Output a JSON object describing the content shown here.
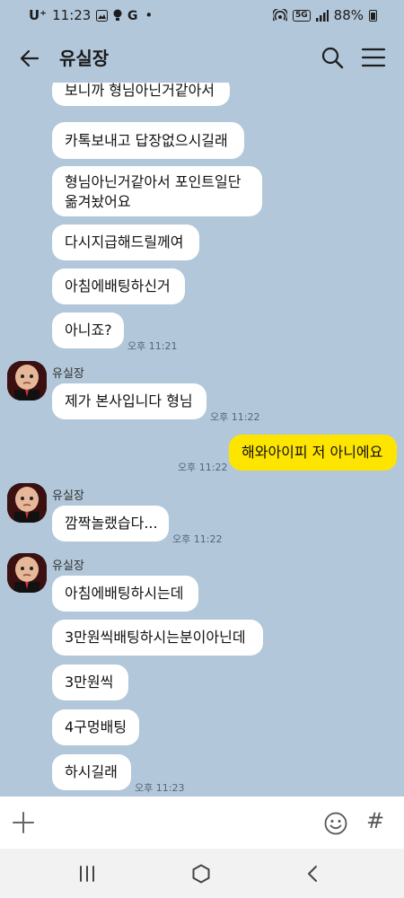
{
  "status_bar": {
    "carrier": "U⁺",
    "time": "11:23",
    "dot": "•",
    "network": "5G",
    "battery": "88%"
  },
  "header": {
    "title": "유실장"
  },
  "messages": [
    {
      "text": "보니까 형님아닌거같아서"
    },
    {
      "text": "카톡보내고 답장없으시길래"
    },
    {
      "line1": "형님아닌거같아서 포인트일단",
      "line2": "옮겨놨어요"
    },
    {
      "text": "다시지급해드릴께여"
    },
    {
      "text": "아침에배팅하신거"
    },
    {
      "text": "아니죠?",
      "time": "오후 11:21"
    },
    {
      "sender": "유실장",
      "text": "제가 본사입니다 형님",
      "time": "오후 11:22"
    },
    {
      "text": "해와아이피 저 아니에요",
      "time": "오후 11:22",
      "mine": true
    },
    {
      "sender": "유실장",
      "text": "깜짝놀랬습다...",
      "time": "오후 11:22"
    },
    {
      "sender": "유실장",
      "text": "아침에배팅하시는데"
    },
    {
      "text": "3만원씩배팅하시는분이아닌데"
    },
    {
      "text": "3만원씩"
    },
    {
      "text": "4구멍배팅"
    },
    {
      "text": "하시길래",
      "time": "오후 11:23"
    }
  ],
  "input_bar": {
    "hash": "#"
  },
  "icons": {
    "back": "arrow-left-icon",
    "search": "search-icon",
    "menu": "hamburger-menu-icon",
    "plus": "plus-icon",
    "emoji": "emoji-icon",
    "nav_recents": "recents-icon",
    "nav_home": "home-icon",
    "nav_back": "chevron-left-icon"
  },
  "colors": {
    "chat_background": "#b2c7d9",
    "incoming_bubble": "#ffffff",
    "outgoing_bubble": "#fee500"
  }
}
